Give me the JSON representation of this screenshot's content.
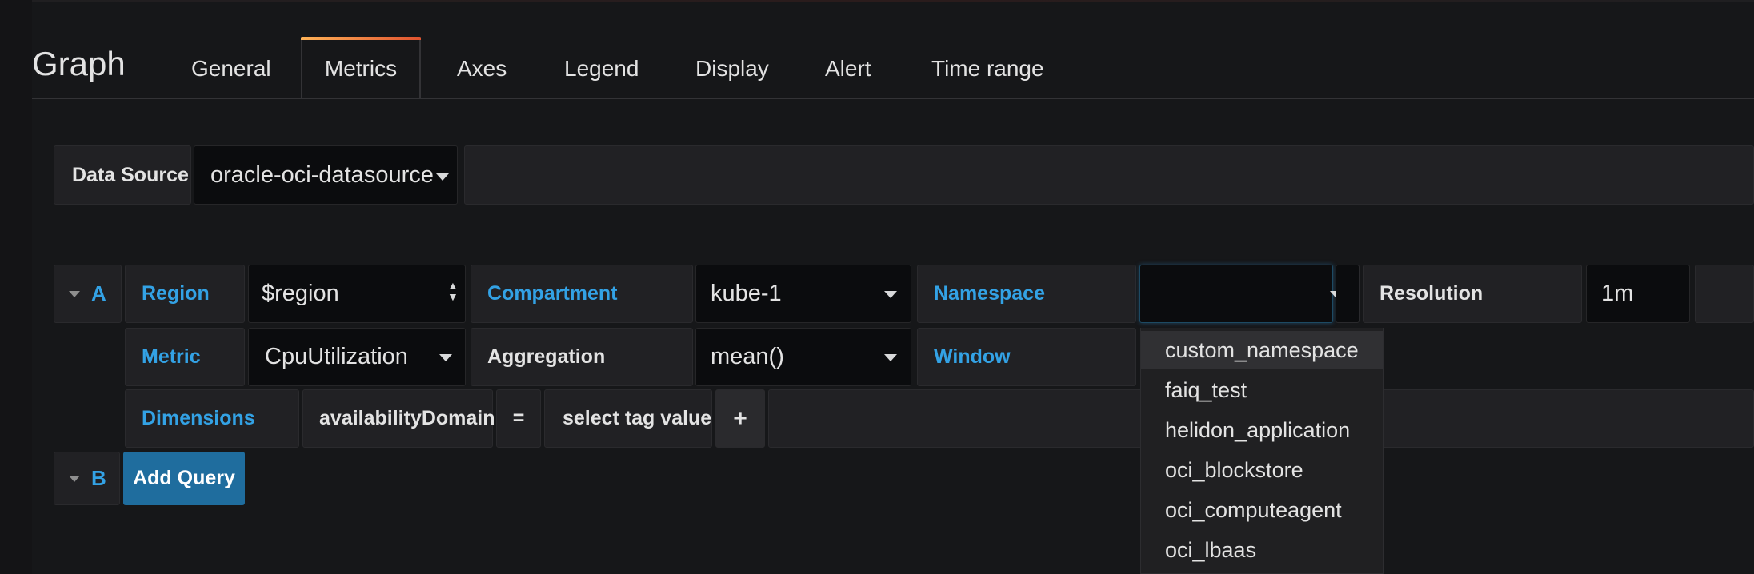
{
  "panel": {
    "title": "Graph"
  },
  "tabs": [
    {
      "label": "General"
    },
    {
      "label": "Metrics"
    },
    {
      "label": "Axes"
    },
    {
      "label": "Legend"
    },
    {
      "label": "Display"
    },
    {
      "label": "Alert"
    },
    {
      "label": "Time range"
    }
  ],
  "datasource": {
    "label": "Data Source",
    "value": "oracle-oci-datasource"
  },
  "query_a": {
    "letter": "A",
    "region_label": "Region",
    "region_value": "$region",
    "compartment_label": "Compartment",
    "compartment_value": "kube-1",
    "namespace_label": "Namespace",
    "namespace_value": "",
    "resolution_label": "Resolution",
    "resolution_value": "1m",
    "metric_label": "Metric",
    "metric_value": "CpuUtilization",
    "aggregation_label": "Aggregation",
    "aggregation_value": "mean()",
    "window_label": "Window",
    "dimensions_label": "Dimensions",
    "dimension_key": "availabilityDomain",
    "dimension_op": "=",
    "dimension_value": "select tag value",
    "add_dimension": "+"
  },
  "query_b": {
    "letter": "B",
    "add_query_label": "Add Query"
  },
  "namespace_dropdown": {
    "options": [
      "custom_namespace",
      "faiq_test",
      "helidon_application",
      "oci_blockstore",
      "oci_computeagent",
      "oci_lbaas"
    ],
    "highlighted_index": 0
  },
  "colors": {
    "accent_blue": "#33a2e5",
    "button_blue": "#1f6d9e",
    "tab_gradient_start": "#ffb357",
    "tab_gradient_end": "#e0532f"
  }
}
